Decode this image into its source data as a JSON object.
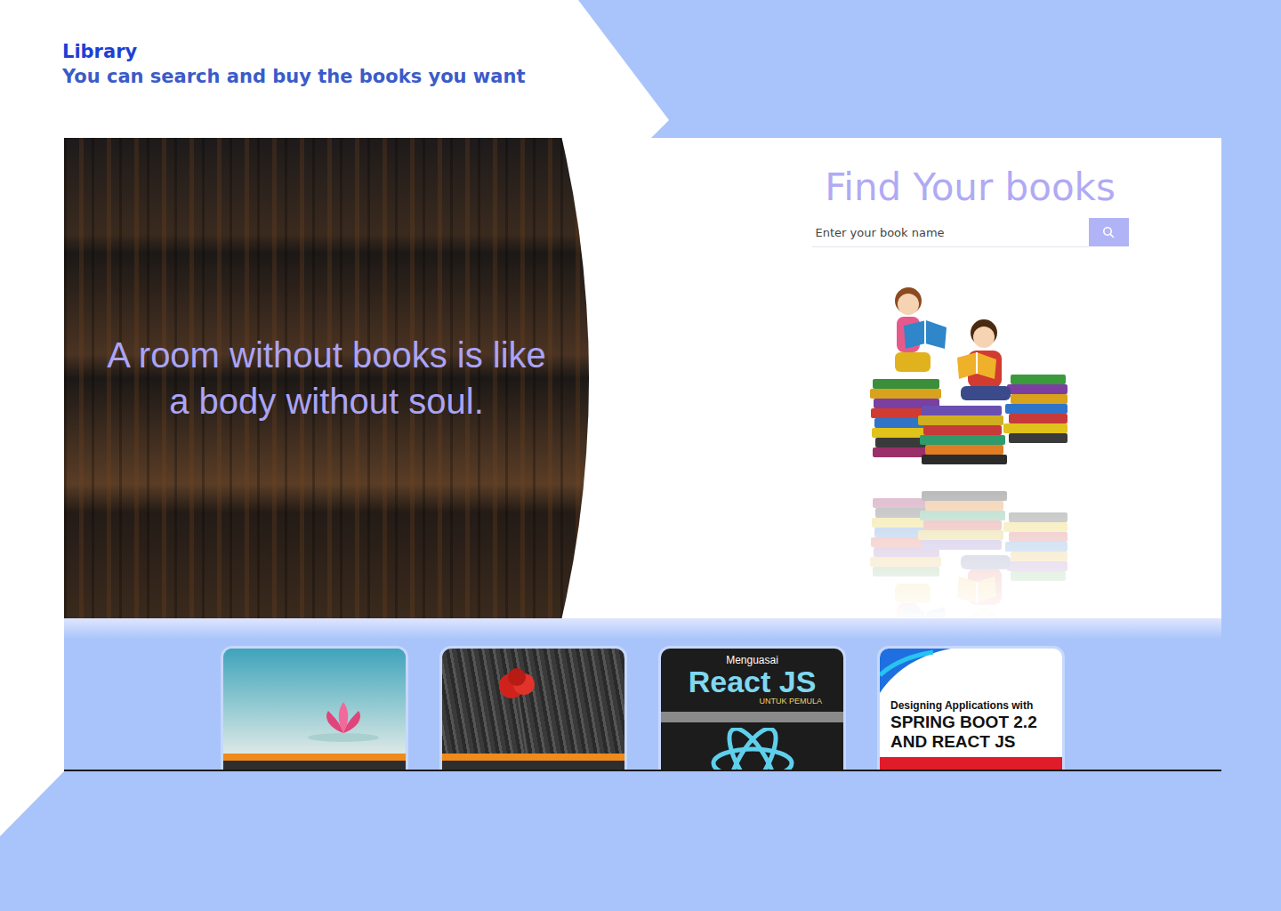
{
  "header": {
    "title": "Library",
    "subtitle": "You can search and buy the books you want"
  },
  "hero": {
    "quote": "A room without books is like a body without soul."
  },
  "search": {
    "title": "Find Your books",
    "placeholder": "Enter your book name"
  },
  "books": [
    {
      "kind": "lotus"
    },
    {
      "kind": "poppy"
    },
    {
      "kind": "react",
      "over": "Menguasai",
      "title": "React JS",
      "sub": "UNTUK PEMULA"
    },
    {
      "kind": "spring",
      "lines": [
        "Designing Applications with",
        "SPRING BOOT 2.2",
        "AND REACT JS"
      ]
    }
  ]
}
